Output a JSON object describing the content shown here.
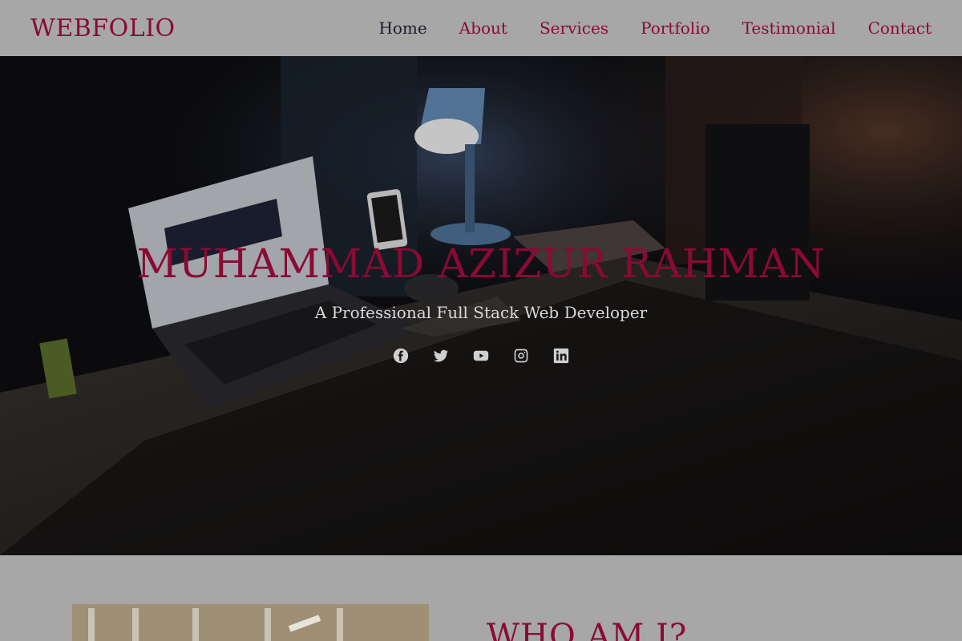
{
  "header": {
    "brand": "WEBFOLIO",
    "nav": [
      {
        "label": "Home",
        "active": true
      },
      {
        "label": "About"
      },
      {
        "label": "Services"
      },
      {
        "label": "Portfolio"
      },
      {
        "label": "Testimonial"
      },
      {
        "label": "Contact"
      }
    ]
  },
  "hero": {
    "title": "MUHAMMAD AZIZUR RAHMAN",
    "subtitle": "A Professional Full Stack Web Developer",
    "socials": [
      "facebook-icon",
      "twitter-icon",
      "youtube-icon",
      "instagram-icon",
      "linkedin-icon"
    ]
  },
  "about": {
    "title": "WHO AM I?"
  },
  "colors": {
    "accent": "#8a0a33",
    "header_bg": "#a7a7a7",
    "hero_text": "#d8d8d8"
  }
}
